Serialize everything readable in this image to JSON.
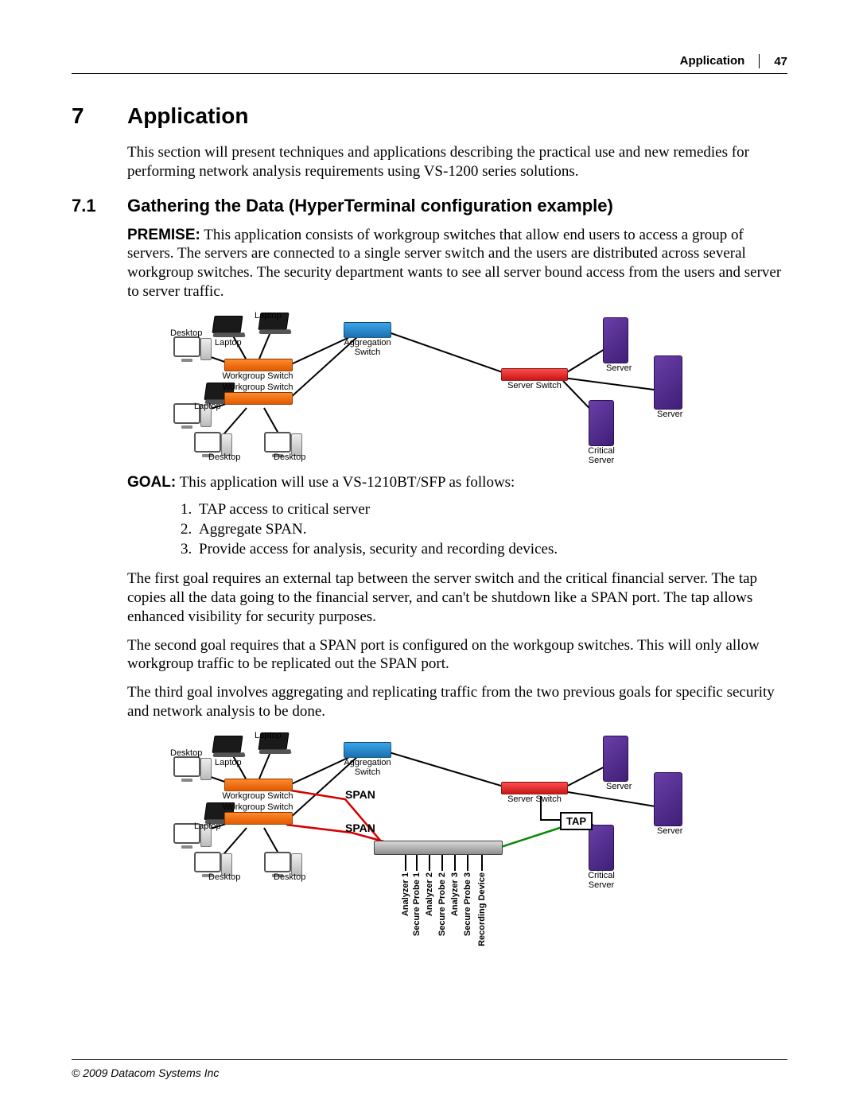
{
  "header": {
    "section_label": "Application",
    "page_number": "47"
  },
  "footer": {
    "copyright": "© 2009 Datacom Systems Inc"
  },
  "chapter": {
    "number": "7",
    "title": "Application"
  },
  "intro": "This section will present techniques and applications describing the practical use and new remedies for performing network analysis requirements using VS-1200 series solutions.",
  "section71": {
    "number": "7.1",
    "title": "Gathering the Data (HyperTerminal configuration example)"
  },
  "premise_label": "PREMISE:",
  "premise_text": "This application consists of  workgroup switches that allow end users to access a group of servers. The servers are connected to a single server switch and the users are distributed across several workgroup switches. The security department wants to see all server bound access from the users and server to server traffic.",
  "goal_label": "GOAL:",
  "goal_text": "This application will use a VS-1210BT/SFP as follows:",
  "goal_items": [
    "TAP access to critical server",
    "Aggregate SPAN.",
    "Provide access for analysis, security and recording devices."
  ],
  "para_goal1": "The first goal requires an external tap between the server switch and the critical financial server. The tap copies all the data going to the financial server, and can't be shutdown like a SPAN port. The tap allows enhanced visibility for security purposes.",
  "para_goal2": "The second goal requires that a SPAN port is configured on the workgoup switches. This will only allow workgroup traffic to be replicated out the SPAN port.",
  "para_goal3": "The third goal involves aggregating and replicating traffic from the two previous goals for specific security and network analysis to be done.",
  "diagram1": {
    "desktop": "Desktop",
    "laptop": "Laptop",
    "workgroup_switch": "Workgroup Switch",
    "aggregation_switch": "Aggregation\nSwitch",
    "server_switch": "Server Switch",
    "server": "Server",
    "critical_server": "Critical\nServer"
  },
  "diagram2": {
    "desktop": "Desktop",
    "laptop": "Laptop",
    "workgroup_switch": "Workgroup Switch",
    "aggregation_switch": "Aggregation\nSwitch",
    "server_switch": "Server Switch",
    "server": "Server",
    "critical_server": "Critical\nServer",
    "span": "SPAN",
    "tap": "TAP",
    "ports": {
      "p1": "Analyzer 1",
      "p2": "Secure Probe 1",
      "p3": "Analyzer 2",
      "p4": "Secure Probe 2",
      "p5": "Analyzer 3",
      "p6": "Secure Probe 3",
      "p7": "Recording Device"
    }
  }
}
